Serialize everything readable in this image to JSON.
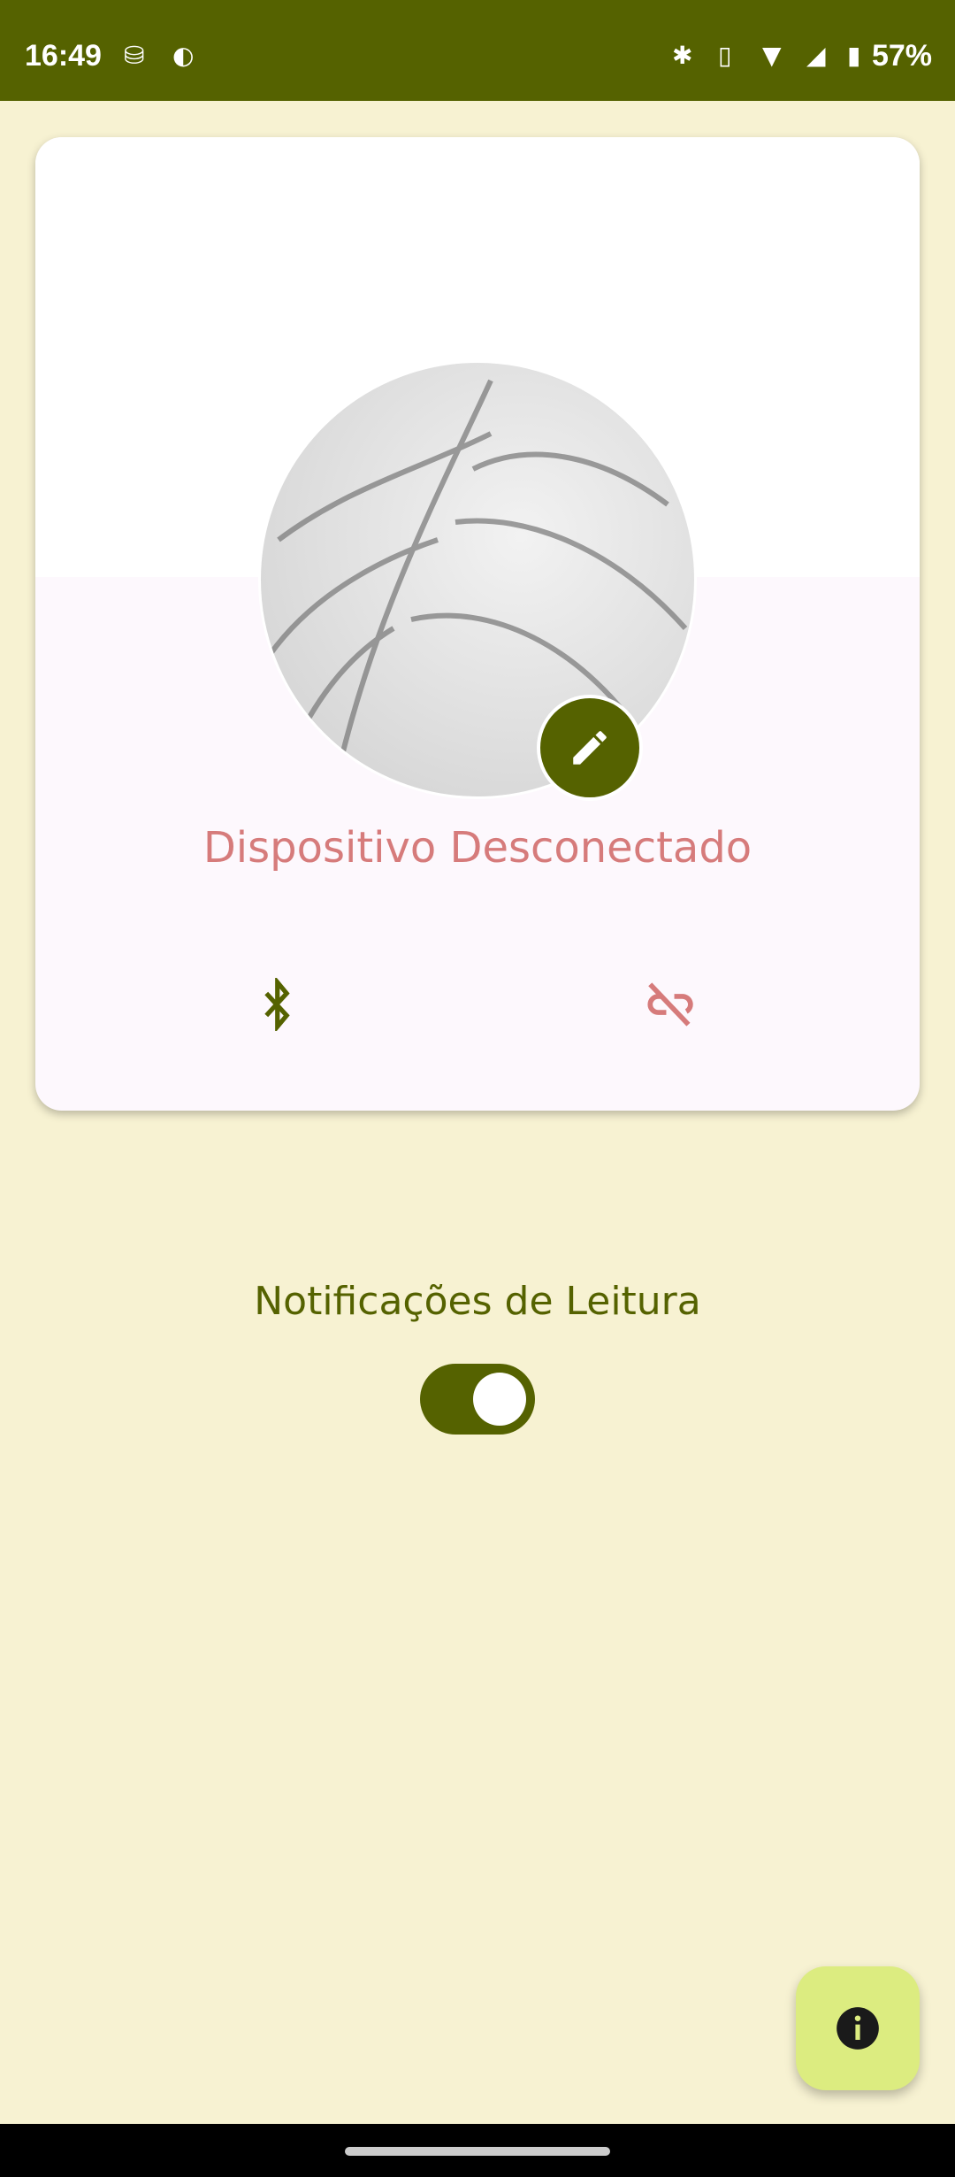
{
  "status_bar": {
    "time": "16:49",
    "battery": "57%",
    "icons": [
      "notification-icon",
      "shield-icon",
      "bluetooth-icon",
      "vibrate-icon",
      "wifi-icon",
      "signal-icon",
      "battery-icon"
    ]
  },
  "device_card": {
    "status_text": "Dispositivo Desconectado",
    "status_color": "#d67b7b",
    "icons": [
      "edit-icon",
      "bluetooth-icon",
      "link-off-icon"
    ]
  },
  "notifications": {
    "label": "Notificações de Leitura",
    "enabled": true
  },
  "fab": {
    "icon": "info-icon"
  },
  "colors": {
    "primary": "#556200",
    "background": "#f7f2d2",
    "fab": "#dcec80"
  }
}
